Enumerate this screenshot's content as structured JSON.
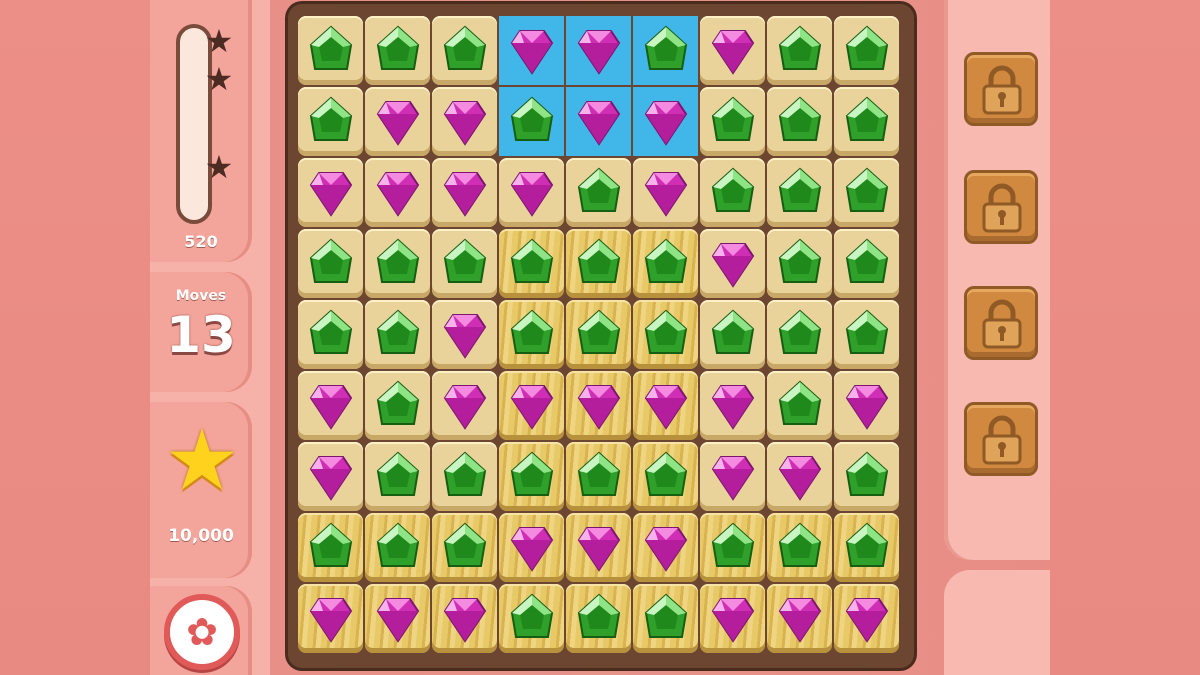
{
  "hud": {
    "score": "520",
    "score_meter_fraction": 0.0,
    "moves_label": "Moves",
    "moves": "13",
    "target_score": "10,000",
    "meter_stars": 3
  },
  "icons": {
    "settings": "gear-icon",
    "target": "star-icon",
    "locks": "padlock-icon"
  },
  "colors": {
    "gem_green": "#2fa02a",
    "gem_pink": "#d02fb5",
    "water": "#40b7e8",
    "settings_ring": "#e15a5a"
  },
  "boosters": [
    {
      "state": "locked"
    },
    {
      "state": "locked"
    },
    {
      "state": "locked"
    },
    {
      "state": "locked"
    }
  ],
  "board": {
    "rows": 9,
    "cols": 9,
    "gems": [
      [
        "G",
        "G",
        "G",
        "P",
        "P",
        "G",
        "P",
        "G",
        "G"
      ],
      [
        "G",
        "P",
        "P",
        "G",
        "P",
        "P",
        "G",
        "G",
        "G"
      ],
      [
        "P",
        "P",
        "P",
        "P",
        "G",
        "P",
        "G",
        "G",
        "G"
      ],
      [
        "G",
        "G",
        "G",
        "G",
        "G",
        "G",
        "P",
        "G",
        "G"
      ],
      [
        "G",
        "G",
        "P",
        "G",
        "G",
        "G",
        "G",
        "G",
        "G"
      ],
      [
        "P",
        "G",
        "P",
        "P",
        "P",
        "P",
        "P",
        "G",
        "P"
      ],
      [
        "P",
        "G",
        "G",
        "G",
        "G",
        "G",
        "P",
        "P",
        "G"
      ],
      [
        "G",
        "G",
        "G",
        "P",
        "P",
        "P",
        "G",
        "G",
        "G"
      ],
      [
        "P",
        "P",
        "P",
        "G",
        "G",
        "G",
        "P",
        "P",
        "P"
      ]
    ],
    "tiles": [
      [
        "s",
        "s",
        "s",
        "w",
        "w",
        "w",
        "s",
        "s",
        "s"
      ],
      [
        "s",
        "s",
        "s",
        "w",
        "w",
        "w",
        "s",
        "s",
        "s"
      ],
      [
        "s",
        "s",
        "s",
        "s",
        "s",
        "s",
        "s",
        "s",
        "s"
      ],
      [
        "s",
        "s",
        "s",
        "b",
        "b",
        "b",
        "s",
        "s",
        "s"
      ],
      [
        "s",
        "s",
        "s",
        "b",
        "b",
        "b",
        "s",
        "s",
        "s"
      ],
      [
        "s",
        "s",
        "s",
        "b",
        "b",
        "b",
        "s",
        "s",
        "s"
      ],
      [
        "s",
        "s",
        "s",
        "b",
        "b",
        "b",
        "s",
        "s",
        "s"
      ],
      [
        "b",
        "b",
        "b",
        "b",
        "b",
        "b",
        "b",
        "b",
        "b"
      ],
      [
        "b",
        "b",
        "b",
        "b",
        "b",
        "b",
        "b",
        "b",
        "b"
      ]
    ]
  }
}
